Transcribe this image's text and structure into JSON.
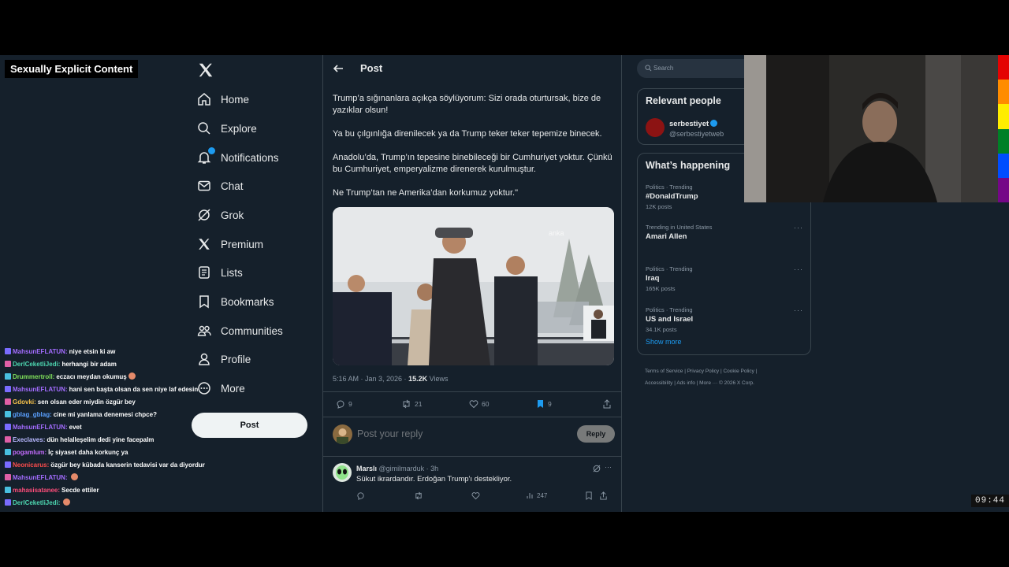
{
  "overlay": {
    "warning": "Sexually Explicit Content",
    "clock": "09:44",
    "chat": [
      {
        "user": "MahsunEFLATUN:",
        "color": "#a36cff",
        "msg": "niye etsin ki aw"
      },
      {
        "user": "DerlCeketliJedi:",
        "color": "#4dd6b0",
        "msg": "herhangi bir adam"
      },
      {
        "user": "Drummertroll:",
        "color": "#7fe05a",
        "msg": "eczacı meydan okumuş"
      },
      {
        "user": "MahsunEFLATUN:",
        "color": "#a36cff",
        "msg": "hani sen başta olsan da sen niye laf edesin"
      },
      {
        "user": "Gdovki:",
        "color": "#f5c04a",
        "msg": "sen olsan eder miydin özgür bey"
      },
      {
        "user": "gblag_gblag:",
        "color": "#5aa0ff",
        "msg": "cine mi yanlama denemesi chpce?"
      },
      {
        "user": "MahsunEFLATUN:",
        "color": "#a36cff",
        "msg": "evet"
      },
      {
        "user": "Execlaves:",
        "color": "#b8b8ff",
        "msg": "dün helalleşelim dedi yine facepalm"
      },
      {
        "user": "pogamlum:",
        "color": "#c56cff",
        "msg": "İç siyaset daha korkunç ya"
      },
      {
        "user": "Neonicarus:",
        "color": "#ff4d4d",
        "msg": "özgür bey kübada kanserin tedavisi var da diyordur"
      },
      {
        "user": "MahsunEFLATUN:",
        "color": "#a36cff",
        "msg": ""
      },
      {
        "user": "mahasisatanee:",
        "color": "#ff4d7a",
        "msg": "Secde ettiler"
      },
      {
        "user": "DerlCeketliJedi:",
        "color": "#4dd6b0",
        "msg": ""
      }
    ]
  },
  "nav": {
    "items": [
      {
        "label": "Home",
        "icon": "home-icon"
      },
      {
        "label": "Explore",
        "icon": "search-icon"
      },
      {
        "label": "Notifications",
        "icon": "bell-icon"
      },
      {
        "label": "Chat",
        "icon": "mail-icon"
      },
      {
        "label": "Grok",
        "icon": "grok-icon"
      },
      {
        "label": "Premium",
        "icon": "x-icon"
      },
      {
        "label": "Lists",
        "icon": "list-icon"
      },
      {
        "label": "Bookmarks",
        "icon": "bookmark-icon"
      },
      {
        "label": "Communities",
        "icon": "people-icon"
      },
      {
        "label": "Profile",
        "icon": "person-icon"
      },
      {
        "label": "More",
        "icon": "more-icon"
      }
    ],
    "post_label": "Post"
  },
  "main": {
    "header_title": "Post",
    "tweet_paragraphs": [
      "Trump’a sığınanlara açıkça söylüyorum: Sizi orada oturtursak, bize de yazıklar olsun!",
      "Ya bu çılgınlığa direnilecek ya da Trump teker teker tepemize binecek.",
      "Anadolu’da, Trump’ın tepesine binebileceği bir Cumhuriyet yoktur. Çünkü bu Cumhuriyet, emperyalizme direnerek kurulmuştur.",
      "Ne Trump’tan ne Amerika’dan korkumuz yoktur.\""
    ],
    "meta_time": "5:16 AM · Jan 3, 2026 ·",
    "meta_views_count": "15.2K",
    "meta_views_label": "Views",
    "stats": {
      "replies": "9",
      "reposts": "21",
      "likes": "60",
      "bookmarks": "9"
    },
    "reply_placeholder": "Post your reply",
    "reply_button": "Reply",
    "reply_tweet": {
      "name": "Marslı",
      "handle": "@gimilmarduk · 3h",
      "text": "Sükut ikrardandır. Erdoğan Trump'ı destekliyor.",
      "views": "247"
    },
    "media_watermark": "anka"
  },
  "right": {
    "search_placeholder": "Search",
    "relevant_title": "Relevant people",
    "person_name": "serbestiyet",
    "person_handle": "@serbestiyetweb",
    "happening_title": "What’s happening",
    "trends": [
      {
        "meta": "Politics · Trending",
        "name": "#DonaldTrump",
        "count": "12K posts"
      },
      {
        "meta": "Trending in United States",
        "name": "Amari Allen",
        "count": ""
      },
      {
        "meta": "Politics · Trending",
        "name": "Iraq",
        "count": "165K posts"
      },
      {
        "meta": "Politics · Trending",
        "name": "US and Israel",
        "count": "34.1K posts"
      }
    ],
    "show_more": "Show more",
    "footer_line1": "Terms of Service  |  Privacy Policy  |  Cookie Policy  |",
    "footer_line2": "Accessibility  |  Ads info  |  More ···  © 2026 X Corp."
  },
  "colors": {
    "accent": "#1d9bf0",
    "background": "#15202b",
    "border": "#38444d"
  }
}
